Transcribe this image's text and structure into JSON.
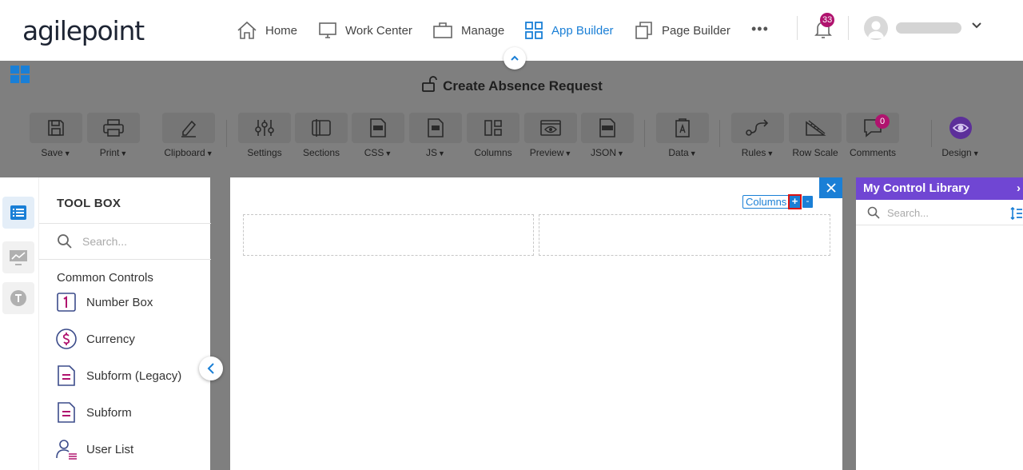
{
  "brand": {
    "logo_text": "agilepoint"
  },
  "nav": {
    "items": [
      {
        "label": "Home"
      },
      {
        "label": "Work Center"
      },
      {
        "label": "Manage"
      },
      {
        "label": "App Builder"
      },
      {
        "label": "Page Builder"
      }
    ],
    "more": "•••",
    "notifications_count": "33",
    "accent_color": "#1a7fd6",
    "badge_color": "#b0136e"
  },
  "form": {
    "title": "Create Absence Request"
  },
  "toolbar": {
    "save": "Save",
    "print": "Print",
    "clipboard": "Clipboard",
    "settings": "Settings",
    "sections": "Sections",
    "css": "CSS",
    "js": "JS",
    "columns": "Columns",
    "preview": "Preview",
    "json": "JSON",
    "data": "Data",
    "rules": "Rules",
    "row_scale": "Row Scale",
    "comments": "Comments",
    "comments_count": "0",
    "design": "Design"
  },
  "toolbox": {
    "title": "TOOL BOX",
    "search_placeholder": "Search...",
    "section": "Common Controls",
    "controls": [
      {
        "label": "Number Box",
        "icon": "number-box-icon"
      },
      {
        "label": "Currency",
        "icon": "currency-icon"
      },
      {
        "label": "Subform (Legacy)",
        "icon": "subform-legacy-icon"
      },
      {
        "label": "Subform",
        "icon": "subform-icon"
      },
      {
        "label": "User List",
        "icon": "user-list-icon"
      }
    ]
  },
  "canvas": {
    "columns_label": "Columns",
    "add_label": "+",
    "remove_label": "-"
  },
  "library": {
    "title": "My Control Library",
    "arrow": "›",
    "search_placeholder": "Search...",
    "header_color": "#7046d3"
  }
}
